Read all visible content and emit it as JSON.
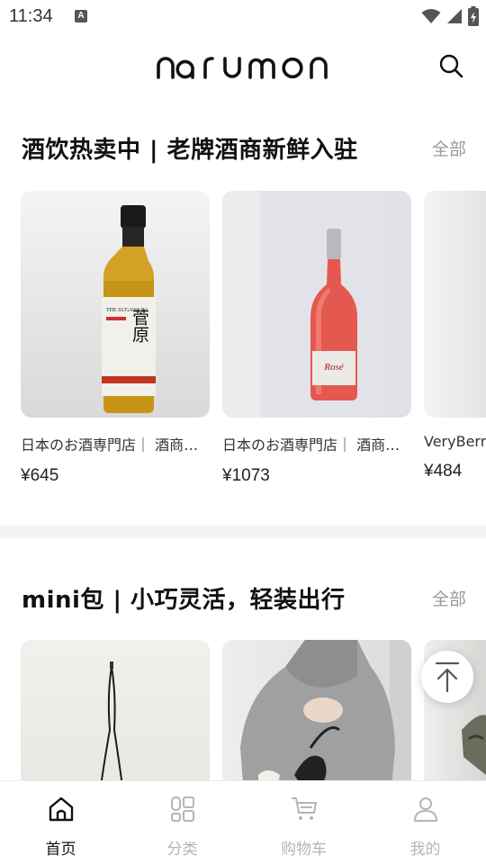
{
  "status_bar": {
    "time": "11:34",
    "notification_badge": "A"
  },
  "header": {
    "logo_text": "narumon",
    "search_icon": "search-icon"
  },
  "sections": [
    {
      "title": "酒饮热卖中 | 老牌酒商新鲜入驻",
      "more_label": "全部",
      "products": [
        {
          "title": "日本のお酒専門店｜ 酒商…",
          "price": "¥645",
          "image": "whisky-bottle"
        },
        {
          "title": "日本のお酒専門店｜ 酒商…",
          "price": "¥1073",
          "image": "rose-wine-bottle"
        },
        {
          "title": "VeryBerry",
          "price": "¥484",
          "image": "grey-product"
        }
      ],
      "whisky_label": {
        "brand": "THE SUGAWARA",
        "kanji": "菅原"
      },
      "wine_label": "Rosé"
    },
    {
      "title": "mini包 | 小巧灵活，轻装出行",
      "more_label": "全部",
      "products": [
        {
          "image": "mini-bag-strap"
        },
        {
          "image": "hoodie-model-with-bag"
        },
        {
          "image": "bag-photo"
        }
      ]
    }
  ],
  "back_to_top_icon": "arrow-up-to-top-icon",
  "bottom_nav": [
    {
      "label": "首页",
      "icon": "home-icon",
      "active": true
    },
    {
      "label": "分类",
      "icon": "category-icon",
      "active": false
    },
    {
      "label": "购物车",
      "icon": "cart-icon",
      "active": false
    },
    {
      "label": "我的",
      "icon": "profile-icon",
      "active": false
    }
  ],
  "colors": {
    "accent": "#111111",
    "inactive": "#b5b5b5",
    "muted": "#999999",
    "divider": "#f4f4f4"
  }
}
